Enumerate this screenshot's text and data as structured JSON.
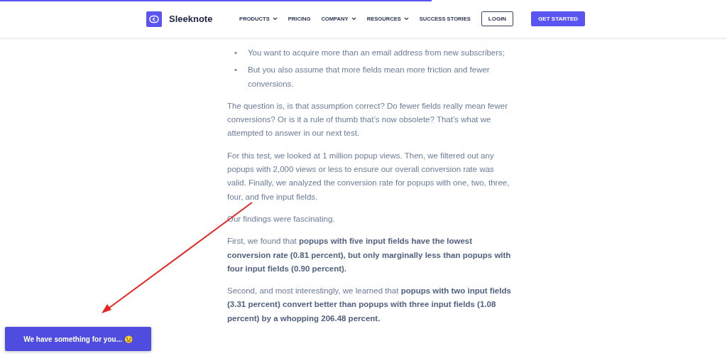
{
  "progress": {
    "level": 0.594
  },
  "header": {
    "logo": "Sleeknote",
    "nav": [
      {
        "label": "PRODUCTS",
        "dropdown": true
      },
      {
        "label": "PRICING",
        "dropdown": false
      },
      {
        "label": "COMPANY",
        "dropdown": true
      },
      {
        "label": "RESOURCES",
        "dropdown": true
      },
      {
        "label": "SUCCESS STORIES",
        "dropdown": false
      }
    ],
    "buttons": [
      {
        "label": "LOGIN",
        "kind": "outline"
      },
      {
        "label": "GET STARTED",
        "kind": "primary"
      }
    ]
  },
  "article": {
    "bullets": [
      {
        "marker": "•",
        "text": "You want to acquire more than an email address from new subscribers;"
      },
      {
        "marker": "•",
        "text": "But you also assume that more fields mean more friction and fewer conversions."
      }
    ],
    "paragraphs": [
      "The question is, is that assumption correct? Do fewer fields really mean fewer conversions? Or is it a rule of thumb that’s now obsolete? That’s what we attempted to answer in our next test.",
      "For this test, we looked at 1 million popup views. Then, we filtered out any popups with 2,000 views or less to ensure our overall conversion rate was valid. Finally, we analyzed the conversion rate for popups with one, two, three, four, and five input fields.",
      "Our findings were fascinating.",
      "First, we found that **popups with five input fields have the lowest conversion rate (0.81 percent), but only marginally less than popups with four input fields (0.90 percent).**",
      "Second, and most interestingly, we learned that **popups with two input fields (3.31 percent) convert better than popups with three input fields (1.08 percent) by a whopping 206.48 percent.**"
    ]
  },
  "widget": {
    "label": "We have something for you... 😉"
  }
}
